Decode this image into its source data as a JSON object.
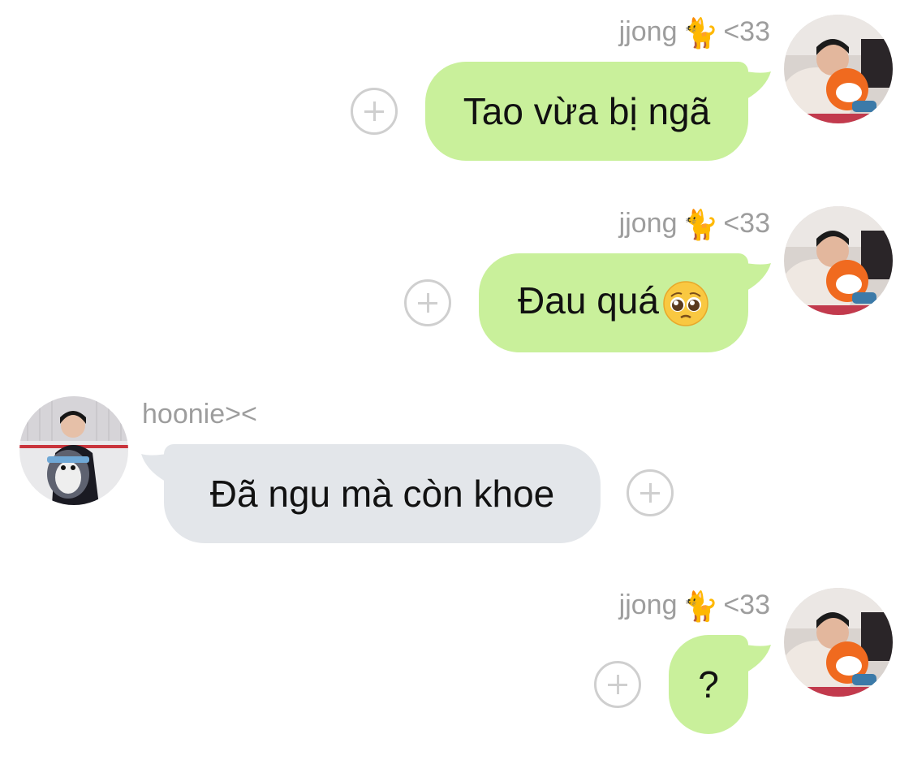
{
  "messages": [
    {
      "sender": "jjong",
      "sender_suffix": "<33",
      "sender_icon": "black-cat-emoji",
      "text": "Tao vừa bị ngã",
      "direction": "outgoing"
    },
    {
      "sender": "jjong",
      "sender_suffix": "<33",
      "sender_icon": "black-cat-emoji",
      "text": "Đau quá",
      "emoji": "pleading-face-emoji",
      "direction": "outgoing"
    },
    {
      "sender": "hoonie><",
      "text": "Đã ngu mà còn khoe",
      "direction": "incoming"
    },
    {
      "sender": "jjong",
      "sender_suffix": "<33",
      "sender_icon": "black-cat-emoji",
      "text": "?",
      "direction": "outgoing"
    }
  ],
  "glyphs": {
    "cat": "🐈"
  },
  "colors": {
    "outgoing_bubble": "#c9f09b",
    "incoming_bubble": "#e3e6ea",
    "name_text": "#9d9d9d",
    "plus_icon": "#cfcfcf"
  }
}
